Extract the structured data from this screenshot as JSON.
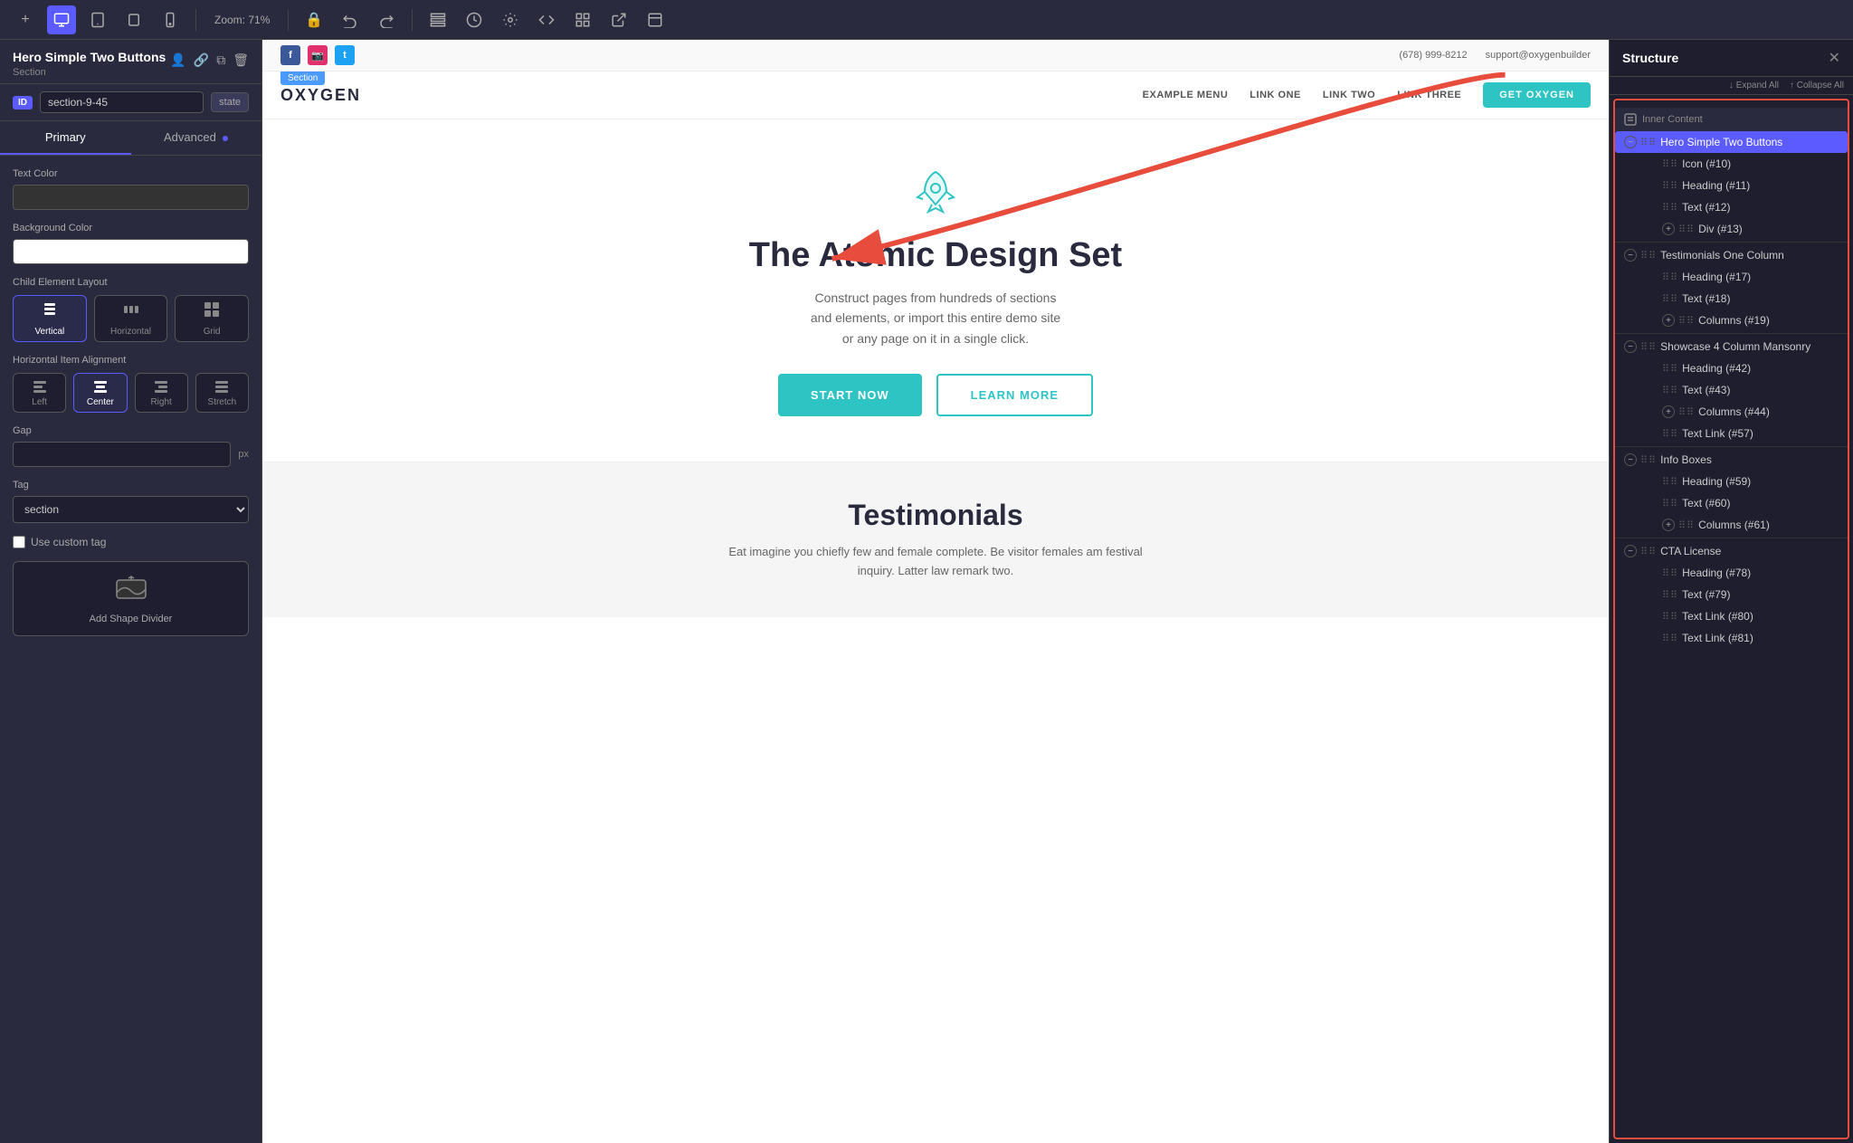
{
  "toolbar": {
    "zoom_label": "Zoom: 71%",
    "add_btn": "+",
    "desktop_icon": "🖥",
    "tablet_icon": "⬜",
    "tablet_small_icon": "▭",
    "mobile_icon": "📱",
    "undo_icon": "↩",
    "redo_icon": "↪",
    "structure_icon": "⊞",
    "history_icon": "🕐",
    "settings_icon": "⚙",
    "code_icon": "</>",
    "grid_icon": "#",
    "export_icon": "↗",
    "template_icon": "⊡",
    "lock_icon": "🔒"
  },
  "left_panel": {
    "title": "Hero Simple Two Buttons",
    "subtitle": "Section",
    "id_label": "ID",
    "id_value": "section-9-45",
    "state_label": "state",
    "tab_primary": "Primary",
    "tab_advanced": "Advanced",
    "text_color_label": "Text Color",
    "bg_color_label": "Background Color",
    "child_layout_label": "Child Element Layout",
    "layout_vertical": "Vertical",
    "layout_horizontal": "Horizontal",
    "layout_grid": "Grid",
    "align_label": "Horizontal Item Alignment",
    "align_left": "Left",
    "align_center": "Center",
    "align_right": "Right",
    "align_stretch": "Stretch",
    "gap_label": "Gap",
    "gap_unit": "px",
    "tag_label": "Tag",
    "tag_value": "section",
    "custom_tag_label": "Use custom tag",
    "add_shape_label": "Add Shape Divider"
  },
  "canvas": {
    "site_topbar_phone": "(678) 999-8212",
    "site_topbar_email": "support@oxygenbuilder",
    "site_logo": "OXYGEN",
    "nav_menu": "EXAMPLE MENU",
    "nav_link1": "LINK ONE",
    "nav_link2": "LINK TWO",
    "nav_link3": "LINK THREE",
    "nav_cta": "GET OXYGEN",
    "section_badge": "Section",
    "hero_title": "The Atomic Design Set",
    "hero_subtitle1": "Construct pages from hundreds of sections",
    "hero_subtitle2": "and elements, or import this entire demo site",
    "hero_subtitle3": "or any page on it in a single click.",
    "hero_btn1": "START NOW",
    "hero_btn2": "LEARN MORE",
    "testimonials_title": "Testimonials",
    "testimonials_text1": "Eat imagine you chiefly few and female complete. Be visitor females am festival",
    "testimonials_text2": "inquiry. Latter law remark two."
  },
  "right_panel": {
    "title": "Structure",
    "expand_all": "↓ Expand All",
    "collapse_all": "↑ Collapse All",
    "inner_content_label": "Inner Content",
    "items": [
      {
        "label": "Hero Simple Two Buttons",
        "level": 0,
        "active": true,
        "collapse": "minus",
        "id": ""
      },
      {
        "label": "Icon (#10)",
        "level": 2,
        "active": false,
        "collapse": null,
        "id": ""
      },
      {
        "label": "Heading (#11)",
        "level": 2,
        "active": false,
        "collapse": null,
        "id": ""
      },
      {
        "label": "Text (#12)",
        "level": 2,
        "active": false,
        "collapse": null,
        "id": ""
      },
      {
        "label": "Div (#13)",
        "level": 2,
        "active": false,
        "collapse": "plus",
        "id": ""
      },
      {
        "label": "Testimonials One Column",
        "level": 0,
        "active": false,
        "collapse": "minus",
        "id": ""
      },
      {
        "label": "Heading (#17)",
        "level": 2,
        "active": false,
        "collapse": null,
        "id": ""
      },
      {
        "label": "Text (#18)",
        "level": 2,
        "active": false,
        "collapse": null,
        "id": ""
      },
      {
        "label": "Columns (#19)",
        "level": 2,
        "active": false,
        "collapse": "plus",
        "id": ""
      },
      {
        "label": "Showcase 4 Column Mansonry",
        "level": 0,
        "active": false,
        "collapse": "minus",
        "id": ""
      },
      {
        "label": "Heading (#42)",
        "level": 2,
        "active": false,
        "collapse": null,
        "id": ""
      },
      {
        "label": "Text (#43)",
        "level": 2,
        "active": false,
        "collapse": null,
        "id": ""
      },
      {
        "label": "Columns (#44)",
        "level": 2,
        "active": false,
        "collapse": "plus",
        "id": ""
      },
      {
        "label": "Text Link (#57)",
        "level": 2,
        "active": false,
        "collapse": null,
        "id": ""
      },
      {
        "label": "Info Boxes",
        "level": 0,
        "active": false,
        "collapse": "minus",
        "id": ""
      },
      {
        "label": "Heading (#59)",
        "level": 2,
        "active": false,
        "collapse": null,
        "id": ""
      },
      {
        "label": "Text (#60)",
        "level": 2,
        "active": false,
        "collapse": null,
        "id": ""
      },
      {
        "label": "Columns (#61)",
        "level": 2,
        "active": false,
        "collapse": "plus",
        "id": ""
      },
      {
        "label": "CTA License",
        "level": 0,
        "active": false,
        "collapse": "minus",
        "id": ""
      },
      {
        "label": "Heading (#78)",
        "level": 2,
        "active": false,
        "collapse": null,
        "id": ""
      },
      {
        "label": "Text (#79)",
        "level": 2,
        "active": false,
        "collapse": null,
        "id": ""
      },
      {
        "label": "Text Link (#80)",
        "level": 2,
        "active": false,
        "collapse": null,
        "id": ""
      },
      {
        "label": "Text Link (#81)",
        "level": 2,
        "active": false,
        "collapse": null,
        "id": ""
      }
    ]
  }
}
